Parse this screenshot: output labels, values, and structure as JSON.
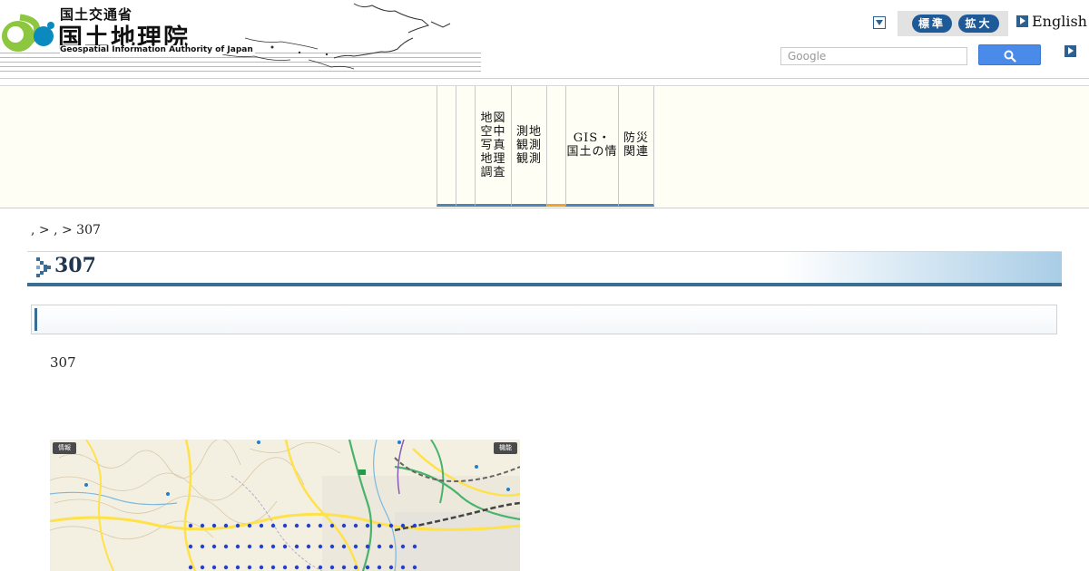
{
  "header": {
    "ministry": "国土交通省",
    "org_name": "国土地理院",
    "org_name_en": "Geospatial Information Authority of Japan",
    "size_standard": "標準",
    "size_large": "拡大",
    "english_link": "English",
    "search_placeholder": "Google"
  },
  "nav": {
    "items": [
      {
        "label": ""
      },
      {
        "label": ""
      },
      {
        "label": "地図\n空中\n写真\n地理\n調査"
      },
      {
        "label": "測地\n観測\n観測"
      },
      {
        "label": ""
      },
      {
        "label": "GIS・\n国土の情"
      },
      {
        "label": "防災\n関連"
      }
    ]
  },
  "breadcrumb": ", > , > 307",
  "page_title": "307",
  "subheading": "",
  "body_text": "307",
  "map": {
    "info_button": "情報",
    "func_button": "機能"
  },
  "colors": {
    "accent_blue": "#3a6d94",
    "nav_active": "#f0a030",
    "nav_bg": "#fffef5",
    "size_button": "#1f5a98",
    "search_button": "#4a8ae8"
  }
}
